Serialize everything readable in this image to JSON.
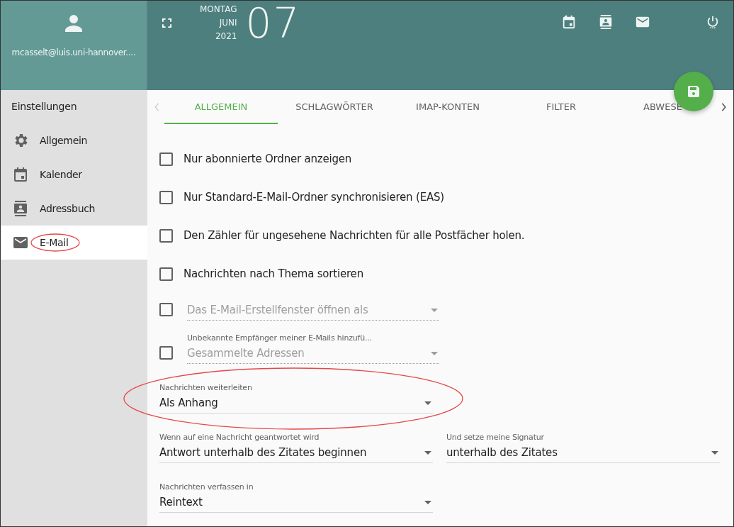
{
  "account": {
    "email": "mcasselt@luis.uni-hannover...."
  },
  "date": {
    "weekday": "MONTAG",
    "month": "JUNI",
    "year": "2021",
    "day": "07"
  },
  "sidebar": {
    "title": "Einstellungen",
    "items": [
      {
        "label": "Allgemein",
        "selected": false
      },
      {
        "label": "Kalender",
        "selected": false
      },
      {
        "label": "Adressbuch",
        "selected": false
      },
      {
        "label": "E-Mail",
        "selected": true,
        "annotated": true
      }
    ]
  },
  "tabs": [
    {
      "label": "ALLGEMEIN",
      "selected": true
    },
    {
      "label": "SCHLAGWÖRTER",
      "selected": false
    },
    {
      "label": "IMAP-KONTEN",
      "selected": false
    },
    {
      "label": "FILTER",
      "selected": false
    },
    {
      "label": "ABWESE",
      "selected": false
    }
  ],
  "rows": [
    {
      "kind": "checkbox",
      "label": "Nur abonnierte Ordner anzeigen",
      "checked": false
    },
    {
      "kind": "checkbox",
      "label": "Nur Standard-E-Mail-Ordner synchronisieren (EAS)",
      "checked": false
    },
    {
      "kind": "checkbox",
      "label": "Den Zähler für ungesehene Nachrichten für alle Postfächer holen.",
      "checked": false
    },
    {
      "kind": "checkbox",
      "label": "Nachrichten nach Thema sortieren",
      "checked": false
    },
    {
      "kind": "checkbox_select",
      "placeholder": "Das E-Mail-Erstellfenster öffnen als",
      "checked": false,
      "disabled": true
    },
    {
      "kind": "checkbox_select",
      "label": "Unbekannte Empfänger meiner E-Mails hinzufü...",
      "placeholder": "Gesammelte Adressen",
      "checked": false,
      "disabled": true
    },
    {
      "kind": "selects",
      "annotated": true,
      "fields": [
        {
          "label": "Nachrichten weiterleiten",
          "value": "Als Anhang"
        }
      ]
    },
    {
      "kind": "selects",
      "fields": [
        {
          "label": "Wenn auf eine Nachricht geantwortet wird",
          "value": "Antwort unterhalb des Zitates beginnen"
        },
        {
          "label": "Und setze meine Signatur",
          "value": "unterhalb des Zitates"
        }
      ]
    },
    {
      "kind": "selects",
      "fields": [
        {
          "label": "Nachrichten verfassen in",
          "value": "Reintext"
        }
      ]
    }
  ]
}
